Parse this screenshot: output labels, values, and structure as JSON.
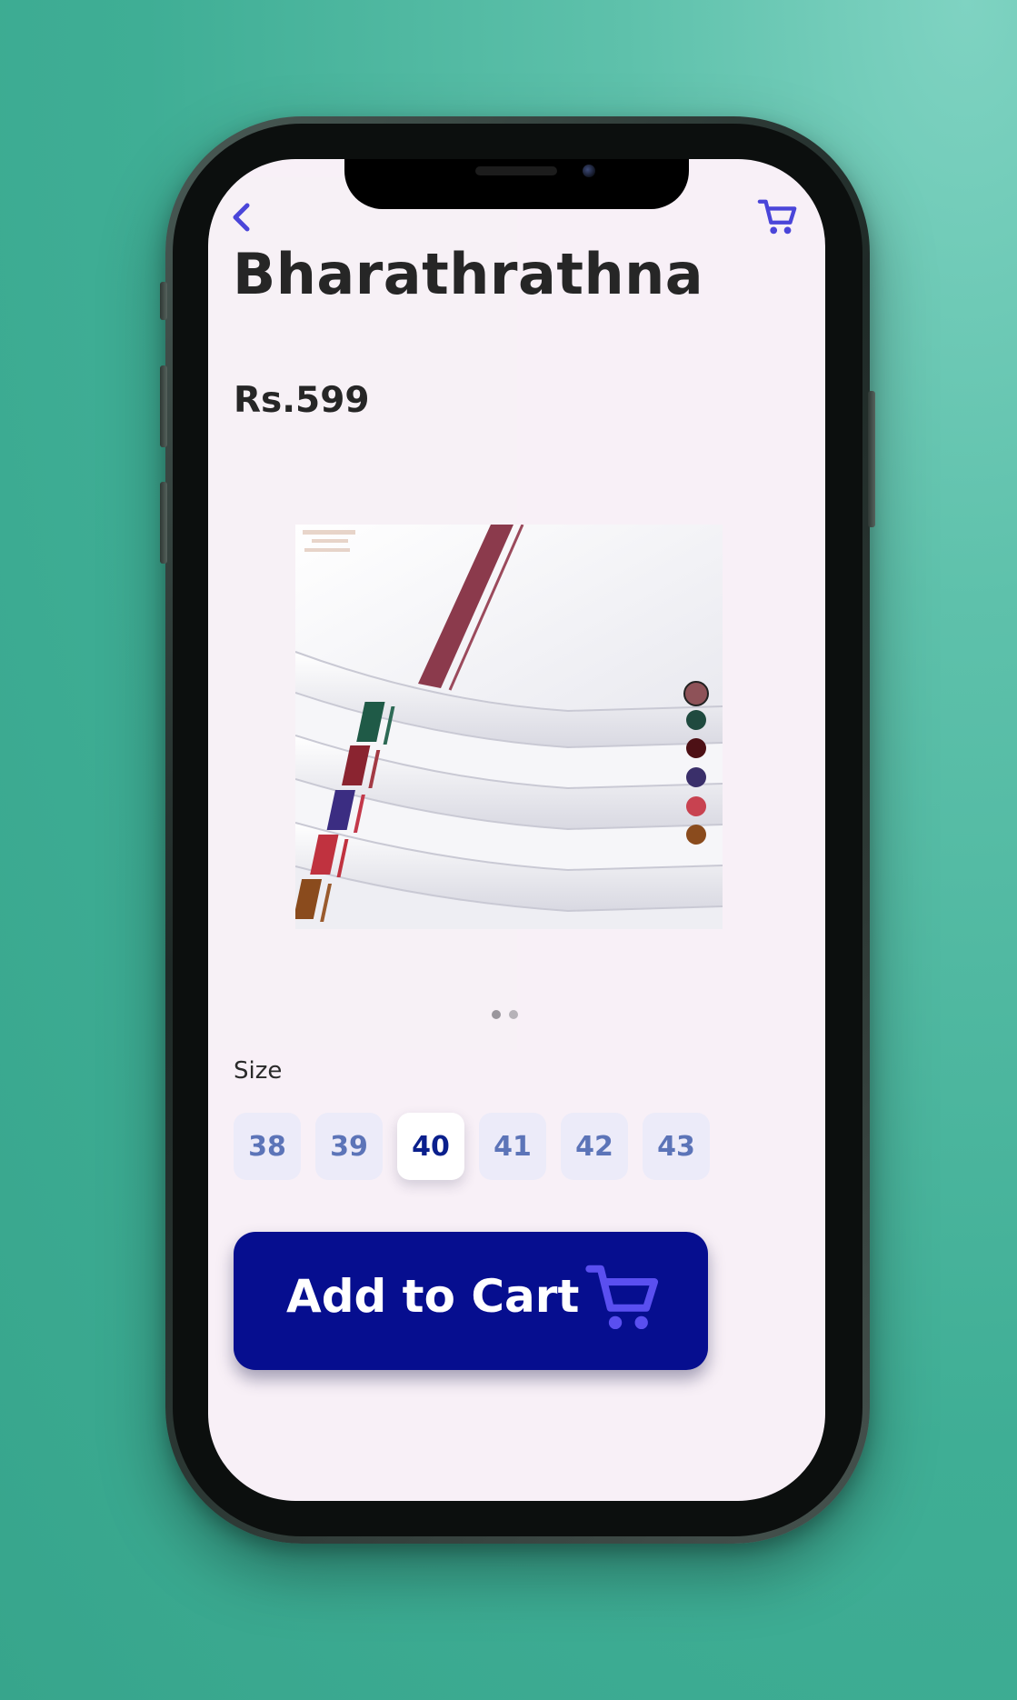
{
  "product": {
    "name": "Bharathrathna",
    "price": "Rs.599"
  },
  "colors": {
    "accent": "#4a45d9",
    "primary_button": "#060e8f",
    "screen_bg": "#f8f0f7"
  },
  "swatches": [
    {
      "color": "#8e5258",
      "selected": true
    },
    {
      "color": "#1f4a3f",
      "selected": false
    },
    {
      "color": "#4d1015",
      "selected": false
    },
    {
      "color": "#3a2f6a",
      "selected": false
    },
    {
      "color": "#c84250",
      "selected": false
    },
    {
      "color": "#8a4b1d",
      "selected": false
    }
  ],
  "carousel": {
    "pages": 2,
    "current": 1
  },
  "sizes": {
    "label": "Size",
    "options": [
      "38",
      "39",
      "40",
      "41",
      "42",
      "43"
    ],
    "selected": "40"
  },
  "add_to_cart": {
    "label": "Add to Cart"
  },
  "icons": {
    "back": "chevron-left-icon",
    "cart": "shopping-cart-icon"
  }
}
